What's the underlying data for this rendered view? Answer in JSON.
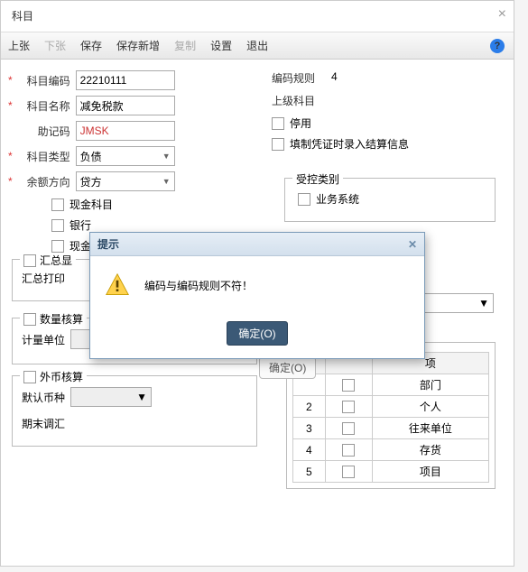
{
  "window": {
    "title": "科目"
  },
  "toolbar": {
    "prev": "上张",
    "next": "下张",
    "save": "保存",
    "saveNew": "保存新增",
    "copy": "复制",
    "settings": "设置",
    "exit": "退出"
  },
  "labels": {
    "code": "科目编码",
    "name": "科目名称",
    "mnemonic": "助记码",
    "type": "科目类型",
    "direction": "余额方向",
    "codeRule": "编码规则",
    "parent": "上级科目",
    "disable": "停用",
    "settle": "填制凭证时录入结算信息",
    "cash": "现金科目",
    "bank": "银行",
    "cash2": "现金",
    "summaryGroup": "汇总显",
    "summaryPrint": "汇总打印",
    "ctrlGroup": "受控类别",
    "biz": "业务系统",
    "qtyGroup": "数量核算",
    "unit": "计量单位",
    "fcGroup": "外币核算",
    "defaultCurrency": "默认币种",
    "periodEnd": "期末调汇"
  },
  "values": {
    "code": "22210111",
    "name": "减免税款",
    "mnemonic": "JMSK",
    "type": "负债",
    "direction": "贷方",
    "codeRule": "4"
  },
  "auxTable": {
    "headers": [
      "",
      "",
      "项"
    ],
    "rows": [
      {
        "n": "",
        "item": "部门"
      },
      {
        "n": "2",
        "item": "个人"
      },
      {
        "n": "3",
        "item": "往来单位"
      },
      {
        "n": "4",
        "item": "存货"
      },
      {
        "n": "5",
        "item": "项目"
      }
    ]
  },
  "dialog": {
    "title": "提示",
    "message": "编码与编码规则不符！",
    "ok": "确定(O)",
    "ghost": "确定(O)"
  }
}
